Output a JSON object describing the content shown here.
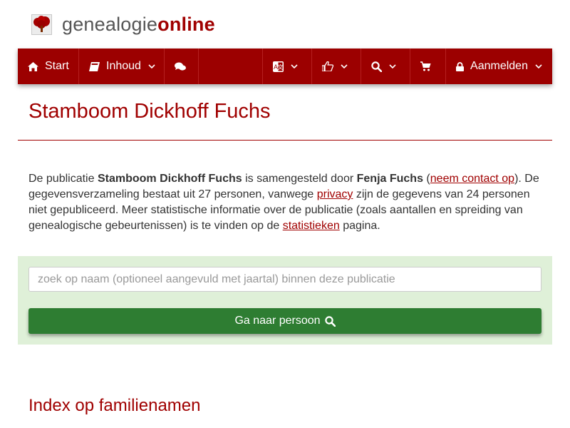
{
  "brand": {
    "part1": "genealogie",
    "part2": "online",
    "accent_color": "#a00000",
    "icon": "tree-logo-icon"
  },
  "navbar": {
    "background": "#9c0000",
    "items": [
      {
        "label": "Start",
        "icon": "home-icon"
      },
      {
        "label": "Inhoud",
        "icon": "book-icon",
        "dropdown": true
      },
      {
        "label": "",
        "icon": "comments-icon"
      },
      {
        "label": "",
        "icon": "language-icon",
        "dropdown": true
      },
      {
        "label": "",
        "icon": "thumbs-up-icon",
        "dropdown": true
      },
      {
        "label": "",
        "icon": "search-icon",
        "dropdown": true
      },
      {
        "label": "",
        "icon": "cart-icon"
      },
      {
        "label": "Aanmelden",
        "icon": "lock-icon",
        "dropdown": true
      }
    ]
  },
  "page": {
    "title": "Stamboom Dickhoff Fuchs"
  },
  "intro": {
    "t1": "De publicatie ",
    "publication": "Stamboom Dickhoff Fuchs",
    "t2": " is samengesteld door ",
    "author": "Fenja Fuchs",
    "t3": " (",
    "contact_link": "neem contact op",
    "t4": "). De gegevensverzameling bestaat uit 27 personen, vanwege ",
    "privacy_link": "privacy",
    "t5": " zijn de gegevens van 24 personen niet gepubliceerd. Meer statistische informatie over de publicatie (zoals aantallen en spreiding van genealogische gebeurtenissen) is te vinden op de ",
    "stats_link": "statistieken",
    "t6": " pagina."
  },
  "search": {
    "placeholder": "zoek op naam (optioneel aangevuld met jaartal) binnen deze publicatie",
    "value": "",
    "button_label": "Ga naar persoon",
    "button_color": "#2e7d32",
    "panel_color": "#dff0d8"
  },
  "section": {
    "title": "Index op familienamen"
  }
}
